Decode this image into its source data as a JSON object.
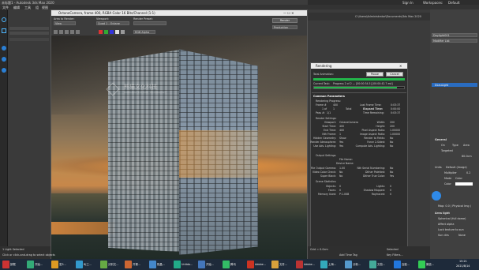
{
  "app": {
    "title": "未标题1 - Autodesk 3ds Max 2020",
    "menus": [
      "文件",
      "编辑",
      "工具",
      "组",
      "视图"
    ]
  },
  "render_window": {
    "title": "OctaneCamera, frame 400, RGBA Color 16 Bits/Channel (1:1)",
    "area_label": "Area to Render:",
    "area_value": "View",
    "viewport_label": "Viewport:",
    "viewport_value": "Quad 1 - Octane",
    "preset_label": "Render Preset:",
    "render_button": "Render",
    "mode_value": "Production",
    "channel_value": "RGB Alpha"
  },
  "progress_dialog": {
    "title": "Rendering",
    "total_animation": "Total Animation:",
    "pause_button": "Pause",
    "cancel_button": "Cancel",
    "current_task": "Current Task:",
    "current_task_value": "Progress 2 of 2 — [00:00:34.5] [00:00:42.7 est]",
    "progress_fraction": 0.92,
    "section_common": "Common Parameters",
    "rendering_progress": "Rendering Progress:",
    "frame_label": "Frame #",
    "frame_value": "400",
    "last_frame_time_label": "Last Frame Time:",
    "last_frame_time": "0:03:37",
    "of_label": "1 of",
    "of_value": "1",
    "total_label": "Total",
    "elapsed_label": "Elapsed Time:",
    "elapsed": "0:00:00",
    "pass_label": "Pass #:",
    "pass_value": "1/1",
    "time_remaining_label": "Time Remaining:",
    "time_remaining": "0:03:37",
    "render_settings": "Render Settings:",
    "settings": [
      [
        "Viewport:",
        "OctaneCamera",
        "Width:",
        "200"
      ],
      [
        "Start Time:",
        "400",
        "Height:",
        "200"
      ],
      [
        "End Time:",
        "400",
        "Pixel Aspect Ratio:",
        "1.00000"
      ],
      [
        "Nth Frame:",
        "1",
        "Image Aspect Ratio:",
        "1.00000"
      ],
      [
        "Hidden Geometry:",
        "Show",
        "Render to Fields:",
        "No"
      ],
      [
        "Render Atmosphere:",
        "Yes",
        "Force 2-Sided:",
        "No"
      ],
      [
        "Use Adv. Lighting:",
        "Yes",
        "Compute Adv. Lighting:",
        "No"
      ]
    ],
    "output_settings": "Output Settings:",
    "file_name_label": "File Name:",
    "device_name_label": "Device Name:",
    "output": [
      [
        "File Output Gamma:",
        "1.00",
        "Nth Serial Numbering:",
        "No"
      ],
      [
        "Video Color Check:",
        "No",
        "Dither Paletted:",
        "No"
      ],
      [
        "Super Black:",
        "No",
        "Dither True Color:",
        "Yes"
      ]
    ],
    "scene_statistics": "Scene Statistics:",
    "stats": [
      [
        "Objects:",
        "0",
        "Lights:",
        "0"
      ],
      [
        "Faces:",
        "0",
        "Shadow Mapped:",
        "0"
      ],
      [
        "Memory Used:",
        "P:1.0KB",
        "Raytraced:",
        "0"
      ]
    ]
  },
  "command_panel": {
    "object_name": "Daylight001",
    "modifier_list": "Modifier List",
    "stack_item": "DLeuLight",
    "general": "General",
    "on_label": "On",
    "type_label": "Type",
    "type_value": "Area",
    "targeted_label": "Targeted",
    "target_value": "80.0cm",
    "units_label": "Units",
    "units_value": "Default (Image)",
    "multiplier_label": "Multiplier",
    "multiplier_value": "0.2",
    "mode_label": "Mode",
    "mode_value": "Color",
    "color_label": "Color",
    "light_source_label": "Area light",
    "spherical_label": "Spherical (full dome)",
    "affect_label": "Affect alpha",
    "lock_label": "Lock texture to sun",
    "sun_label": "Sun dirs",
    "sun_value": "None",
    "tint_label": "Map: 0.0 ( Physical Img )"
  },
  "status": {
    "line1": "1 Light Selected",
    "line2": "Click or click-and-drag to select objects",
    "add_time_tag": "Add Time Tag",
    "grid": "Grid = 0.0cm",
    "set_key": "Set Key",
    "key_filters": "Key Filters...",
    "selected": "Selected"
  },
  "taskbar": {
    "items": [
      "卸载",
      "开始...",
      "发3...",
      "BJ工...",
      "分别文...",
      "开课...",
      "阳晶...",
      "Unitdo...",
      "开始...",
      "腾讯",
      "Adobe...",
      "文件...",
      "Adobe...",
      "上海...",
      "分新...",
      "文档...",
      "百度...",
      "微信..."
    ],
    "time": "15:21",
    "date": "2021/8/14"
  },
  "watermark": {
    "cn": "熊猫文化科技",
    "en": "XIONGMAO CULTURE TECHNOLOGY"
  },
  "sign_in": "Sign In",
  "workspaces_label": "Workspaces:",
  "workspaces_value": "Default",
  "path": "C:\\Users\\Administrator\\Documents\\3ds Max 2020"
}
